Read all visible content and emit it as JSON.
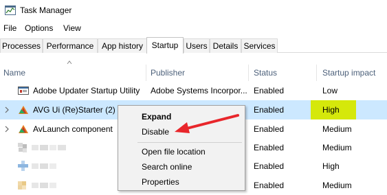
{
  "window": {
    "title": "Task Manager"
  },
  "menu": {
    "file": "File",
    "options": "Options",
    "view": "View"
  },
  "tabs": {
    "processes": "Processes",
    "performance": "Performance",
    "app_history": "App history",
    "startup": "Startup",
    "users": "Users",
    "details": "Details",
    "services": "Services"
  },
  "columns": {
    "name": "Name",
    "publisher": "Publisher",
    "status": "Status",
    "impact": "Startup impact"
  },
  "rows": [
    {
      "name": "Adobe Updater Startup Utility",
      "publisher": "Adobe Systems Incorpor...",
      "status": "Enabled",
      "impact": "Low"
    },
    {
      "name": "AVG Ui (Re)Starter (2)",
      "publisher": "",
      "status": "Enabled",
      "impact": "High"
    },
    {
      "name": "AvLaunch component",
      "publisher": "",
      "status": "Enabled",
      "impact": "Medium"
    },
    {
      "name": "",
      "publisher": "",
      "status": "Enabled",
      "impact": "Medium"
    },
    {
      "name": "",
      "publisher": "",
      "status": "Enabled",
      "impact": "High"
    },
    {
      "name": "",
      "publisher": "",
      "status": "Enabled",
      "impact": "Medium"
    }
  ],
  "context_menu": {
    "expand": "Expand",
    "disable": "Disable",
    "open_file_location": "Open file location",
    "search_online": "Search online",
    "properties": "Properties"
  },
  "colors": {
    "selected_row": "#cce8ff",
    "high_impact_highlight": "#d5e80b",
    "annotation_arrow": "#e8262b"
  },
  "icons": {
    "app": "task-manager-icon",
    "sort": "sort-up-caret-icon",
    "expand": "chevron-right-icon"
  }
}
